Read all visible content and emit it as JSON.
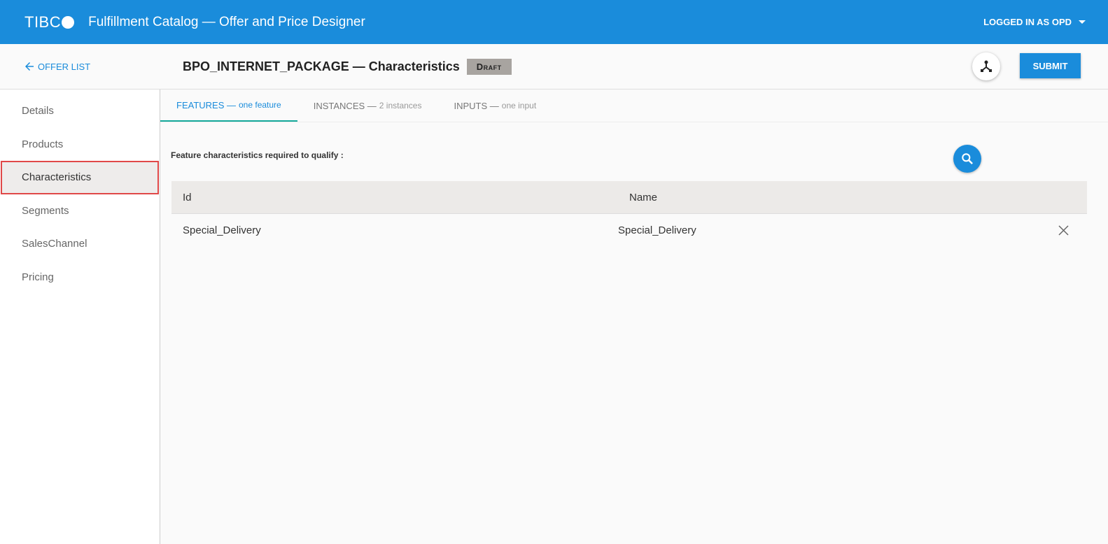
{
  "header": {
    "logo": "TIBCO",
    "title": "Fulfillment Catalog — Offer and Price Designer",
    "user": "LOGGED IN AS OPD"
  },
  "subbar": {
    "back_label": "OFFER LIST",
    "title": "BPO_INTERNET_PACKAGE — Characteristics",
    "status": "Draft",
    "submit_label": "SUBMIT"
  },
  "sidebar": {
    "items": [
      {
        "label": "Details"
      },
      {
        "label": "Products"
      },
      {
        "label": "Characteristics"
      },
      {
        "label": "Segments"
      },
      {
        "label": "SalesChannel"
      },
      {
        "label": "Pricing"
      }
    ]
  },
  "tabs": [
    {
      "label": "FEATURES —",
      "count": "one feature"
    },
    {
      "label": "INSTANCES —",
      "count": "2 instances"
    },
    {
      "label": "INPUTS —",
      "count": "one input"
    }
  ],
  "main": {
    "requirement_label": "Feature characteristics required to qualify :",
    "columns": [
      "Id",
      "Name"
    ],
    "rows": [
      {
        "id": "Special_Delivery",
        "name": "Special_Delivery"
      }
    ]
  }
}
